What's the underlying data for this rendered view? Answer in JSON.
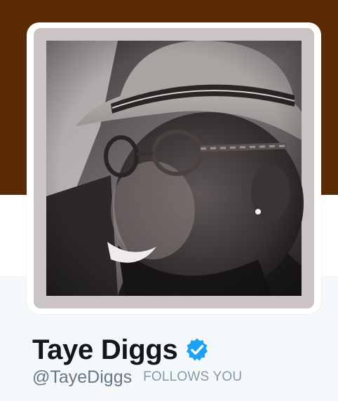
{
  "profile": {
    "display_name": "Taye Diggs",
    "screen_name": "@TayeDiggs",
    "follows_you_label": "FOLLOWS YOU",
    "verified": true
  },
  "icons": {
    "verified": "verified-badge-icon"
  },
  "colors": {
    "header_banner": "#5b2c04",
    "verified_badge": "#1da1f2",
    "display_name": "#14171a",
    "screen_name": "#657786",
    "follows_you": "#8899a6",
    "page_background": "#f5f8fa"
  }
}
